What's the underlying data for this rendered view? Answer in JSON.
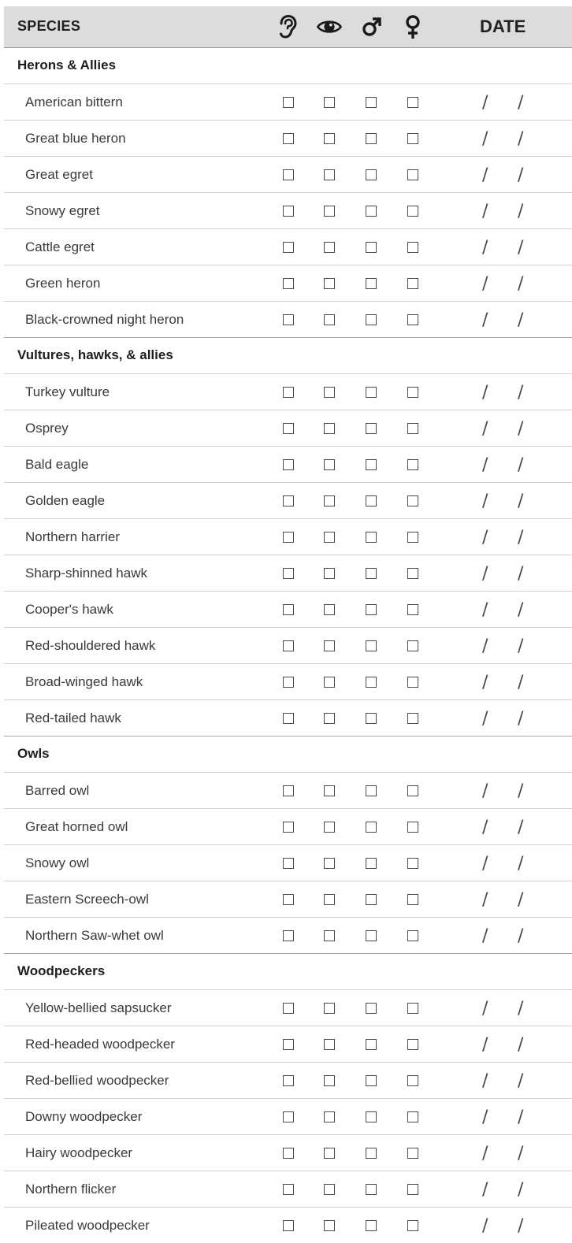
{
  "header": {
    "species_label": "SPECIES",
    "date_label": "DATE",
    "icons": [
      "ear-icon",
      "eye-icon",
      "male-symbol-icon",
      "female-symbol-icon"
    ]
  },
  "date_separator": "/",
  "groups": [
    {
      "name": "Herons & Allies",
      "species": [
        "American bittern",
        "Great blue heron",
        "Great egret",
        "Snowy egret",
        "Cattle egret",
        "Green heron",
        "Black-crowned night heron"
      ]
    },
    {
      "name": "Vultures, hawks, & allies",
      "species": [
        "Turkey vulture",
        "Osprey",
        "Bald eagle",
        "Golden eagle",
        "Northern harrier",
        "Sharp-shinned hawk",
        "Cooper's hawk",
        "Red-shouldered hawk",
        "Broad-winged hawk",
        "Red-tailed hawk"
      ]
    },
    {
      "name": "Owls",
      "species": [
        "Barred owl",
        "Great horned owl",
        "Snowy owl",
        "Eastern Screech-owl",
        "Northern Saw-whet owl"
      ]
    },
    {
      "name": "Woodpeckers",
      "species": [
        "Yellow-bellied sapsucker",
        "Red-headed woodpecker",
        "Red-bellied woodpecker",
        "Downy woodpecker",
        "Hairy woodpecker",
        "Northern flicker",
        "Pileated woodpecker"
      ]
    }
  ]
}
